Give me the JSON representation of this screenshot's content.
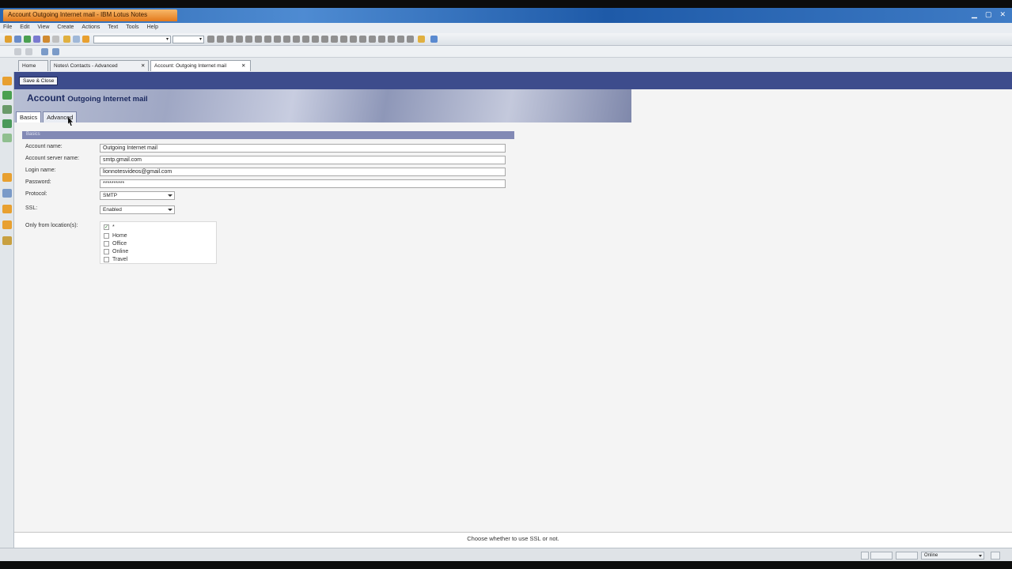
{
  "window": {
    "title": "Account Outgoing Internet mail - IBM Lotus Notes",
    "second_tab": ""
  },
  "menubar": [
    "File",
    "Edit",
    "View",
    "Create",
    "Actions",
    "Text",
    "Tools",
    "Help"
  ],
  "tabs": [
    {
      "label": "Home",
      "active": false
    },
    {
      "label": "Notes\\ Contacts - Advanced",
      "active": false
    },
    {
      "label": "Account: Outgoing Internet mail",
      "active": true
    }
  ],
  "actionbar": {
    "save_label": "Save & Close"
  },
  "banner": {
    "title": "Account",
    "subtitle": "Outgoing Internet mail"
  },
  "form_tabs": [
    {
      "label": "Basics",
      "active": true
    },
    {
      "label": "Advanced",
      "active": false
    }
  ],
  "section": {
    "label": "Basics"
  },
  "fields": {
    "account_name": {
      "label": "Account name:",
      "value": "Outgoing Internet mail"
    },
    "server_name": {
      "label": "Account server name:",
      "value": "smtp.gmail.com"
    },
    "login_name": {
      "label": "Login name:",
      "value": "lionnotesvideos@gmail.com"
    },
    "password": {
      "label": "Password:",
      "value": "**********"
    },
    "protocol": {
      "label": "Protocol:",
      "value": "SMTP"
    },
    "ssl": {
      "label": "SSL:",
      "value": "Enabled"
    },
    "locations": {
      "label": "Only from location(s):",
      "items": [
        {
          "label": "*",
          "checked": true
        },
        {
          "label": "Home",
          "checked": false
        },
        {
          "label": "Office",
          "checked": false
        },
        {
          "label": "Online",
          "checked": false
        },
        {
          "label": "Travel",
          "checked": false
        }
      ]
    }
  },
  "status": {
    "hint": "Choose whether to use SSL or not."
  },
  "bottombar": {
    "location": "Online"
  },
  "colors": {
    "actionbar": "#3d4c8c",
    "section_header": "#8289b5",
    "banner_title": "#1c2a60",
    "active_title_tab": "#e47a1c"
  }
}
